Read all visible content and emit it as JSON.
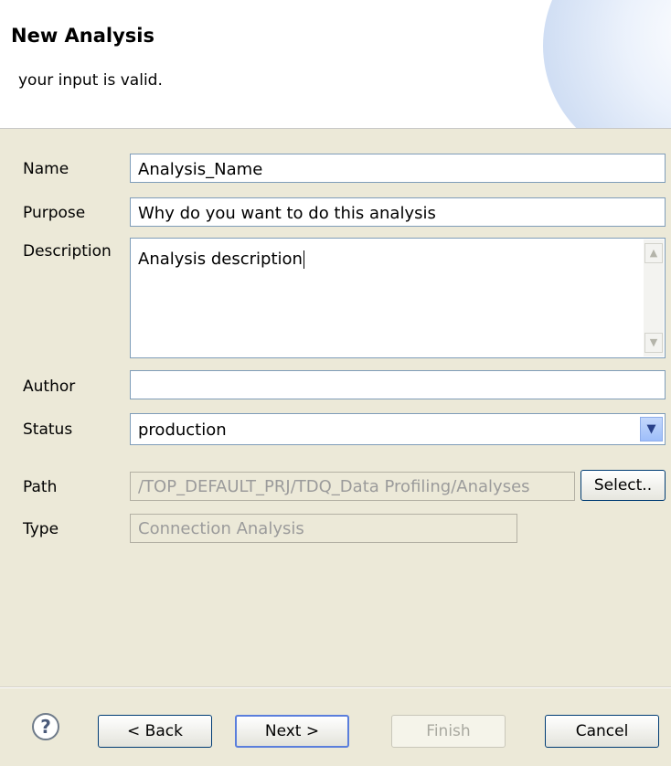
{
  "header": {
    "title": "New Analysis",
    "message": "your input is valid."
  },
  "form": {
    "name_label": "Name",
    "name_value": "Analysis_Name",
    "purpose_label": "Purpose",
    "purpose_value": "Why do you want to do this analysis",
    "description_label": "Description",
    "description_value": "Analysis description",
    "author_label": "Author",
    "author_value": "",
    "status_label": "Status",
    "status_value": "production",
    "path_label": "Path",
    "path_value": "/TOP_DEFAULT_PRJ/TDQ_Data Profiling/Analyses",
    "select_label": "Select..",
    "type_label": "Type",
    "type_value": "Connection Analysis"
  },
  "footer": {
    "back": "< Back",
    "next": "Next >",
    "finish": "Finish",
    "cancel": "Cancel",
    "help": "?"
  },
  "icons": {
    "help": "help-icon",
    "scroll_up": "scroll-up-icon",
    "scroll_down": "scroll-down-icon",
    "dropdown": "chevron-down-icon"
  },
  "colors": {
    "header_bg": "#ffffff",
    "body_bg": "#ece9d8",
    "field_border": "#7f9db9",
    "disabled_text": "#9b9b9b"
  }
}
